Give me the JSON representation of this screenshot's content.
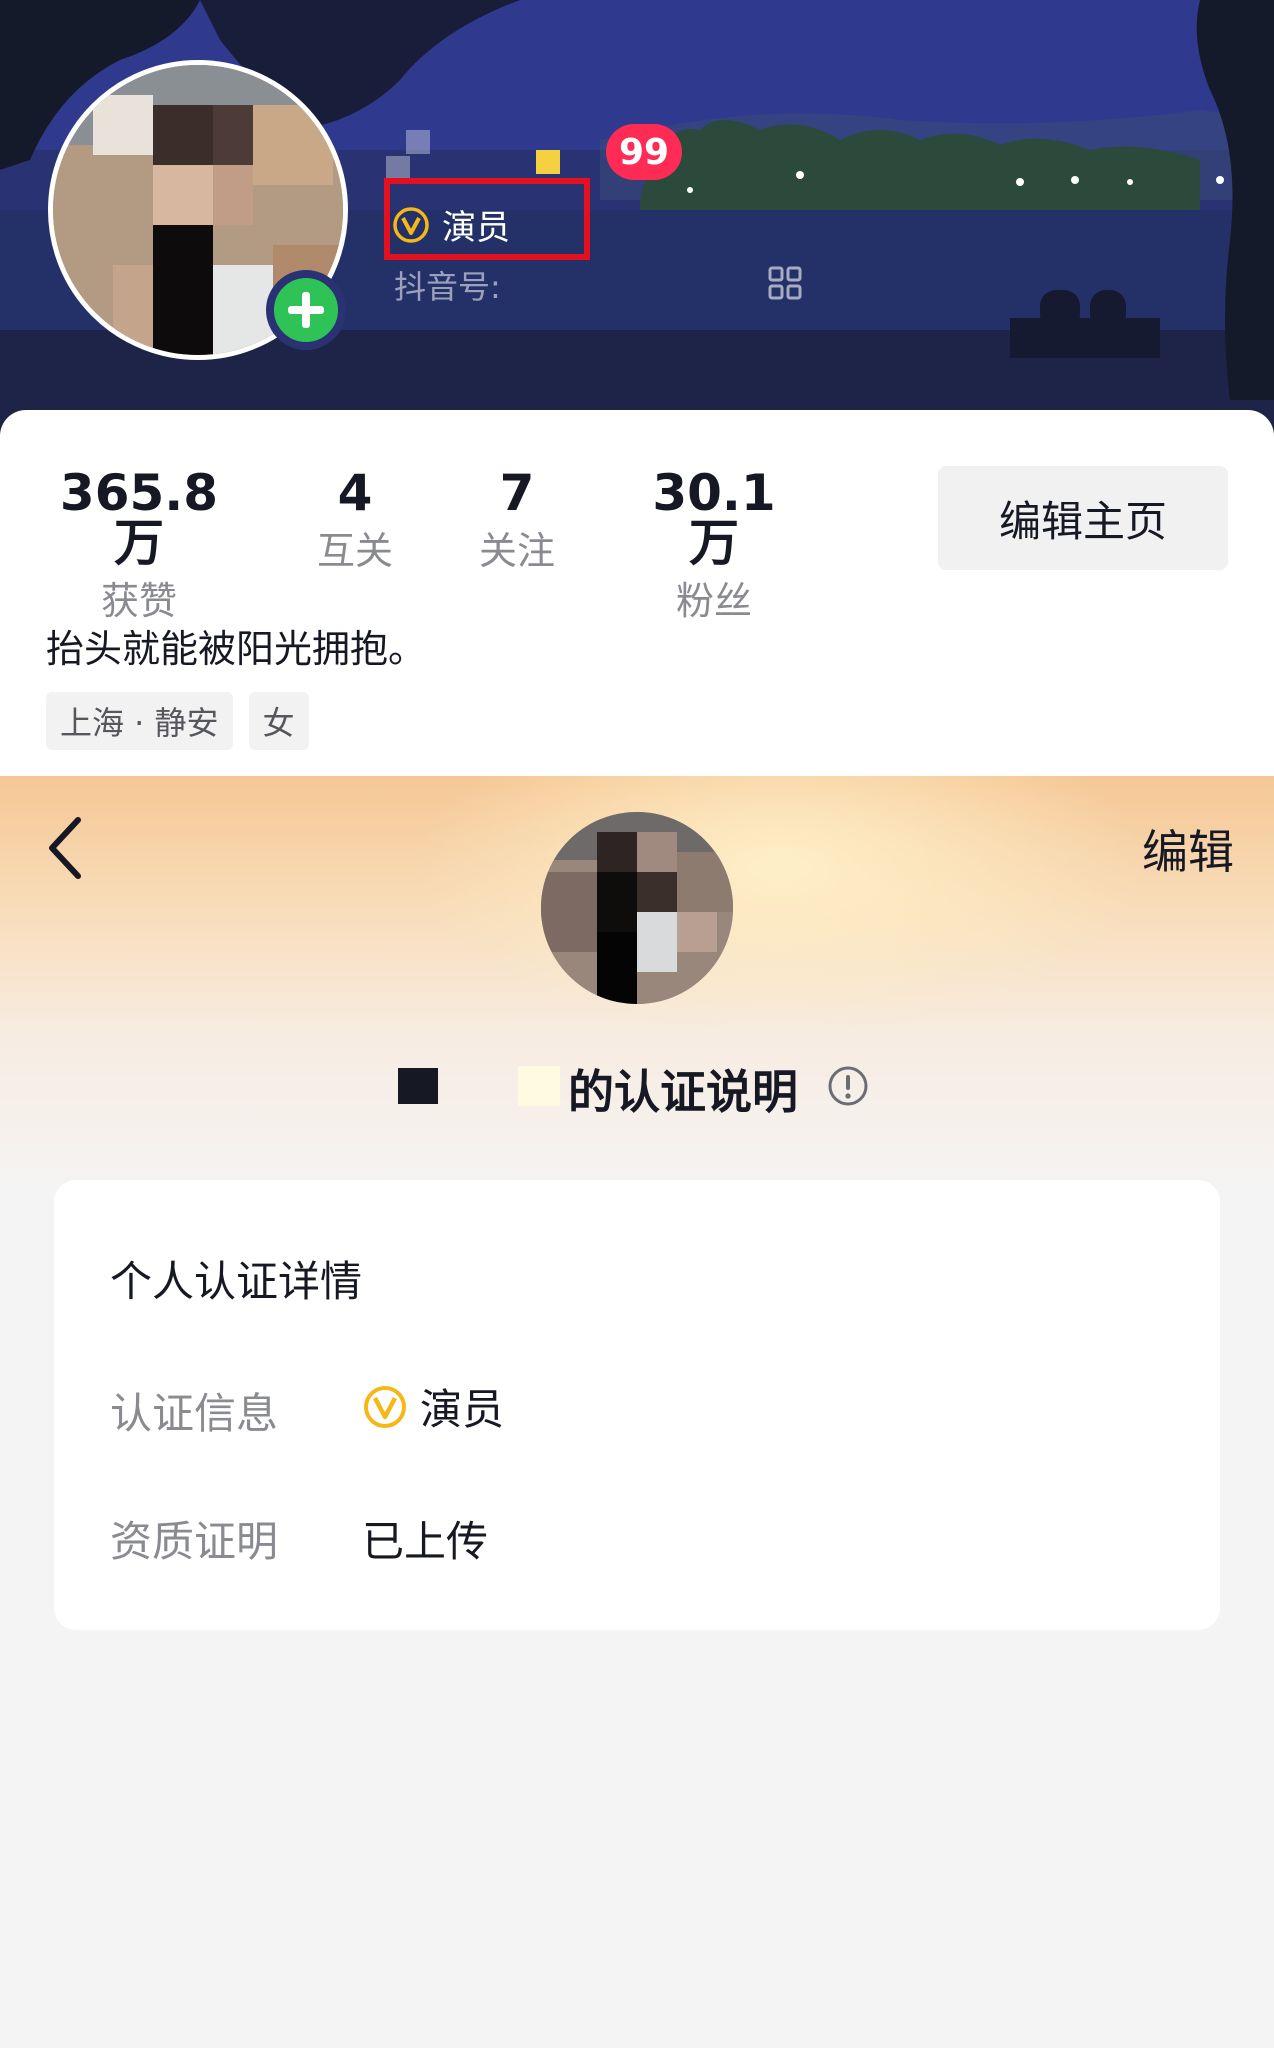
{
  "profile_header": {
    "notification_badge": "99",
    "certification_label": "演员",
    "douyin_id_label": "抖音号:",
    "icons": {
      "add": "plus-icon",
      "cert": "v-badge-icon",
      "qr": "qr-code-icon"
    }
  },
  "stats": [
    {
      "value": "365.8万",
      "label": "获赞"
    },
    {
      "value": "4",
      "label": "互关"
    },
    {
      "value": "7",
      "label": "关注"
    },
    {
      "value": "30.1万",
      "label": "粉丝"
    }
  ],
  "edit_home_label": "编辑主页",
  "bio": "抬头就能被阳光拥抱。",
  "tags": [
    "上海 · 静安",
    "女"
  ],
  "cert_page": {
    "edit_label": "编辑",
    "title": "的认证说明",
    "card": {
      "heading": "个人认证详情",
      "rows": [
        {
          "label": "认证信息",
          "value": "演员"
        },
        {
          "label": "资质证明",
          "value": "已上传"
        }
      ]
    }
  },
  "colors": {
    "accent_badge": "#fe2c55",
    "highlight_box": "#e3101f",
    "add_button": "#2fc257",
    "cert_gold": "#f5b818"
  }
}
